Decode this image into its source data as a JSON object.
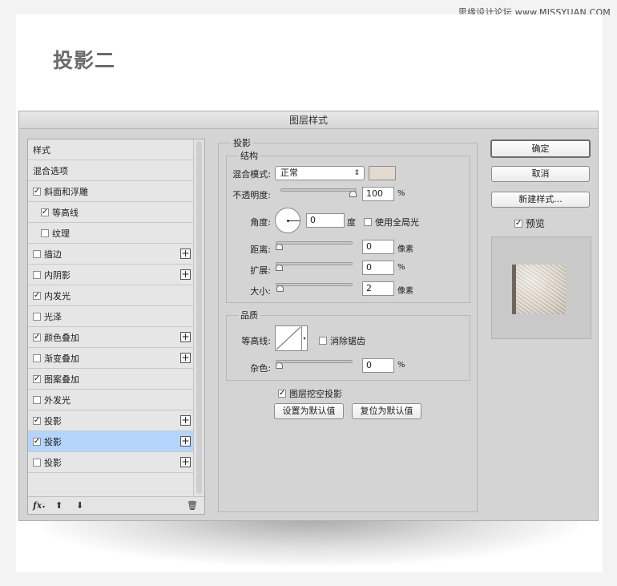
{
  "watermark": "思缘设计论坛 www.MISSYUAN.COM",
  "page_title": "投影二",
  "dialog": {
    "title": "图层样式",
    "style_list": {
      "items": [
        {
          "label": "样式",
          "checkbox": false,
          "checked": false,
          "plus": false,
          "indent": false,
          "selected": false
        },
        {
          "label": "混合选项",
          "checkbox": false,
          "checked": false,
          "plus": false,
          "indent": false,
          "selected": false
        },
        {
          "label": "斜面和浮雕",
          "checkbox": true,
          "checked": true,
          "plus": false,
          "indent": false,
          "selected": false
        },
        {
          "label": "等高线",
          "checkbox": true,
          "checked": true,
          "plus": false,
          "indent": true,
          "selected": false
        },
        {
          "label": "纹理",
          "checkbox": true,
          "checked": false,
          "plus": false,
          "indent": true,
          "selected": false
        },
        {
          "label": "描边",
          "checkbox": true,
          "checked": false,
          "plus": true,
          "indent": false,
          "selected": false
        },
        {
          "label": "内阴影",
          "checkbox": true,
          "checked": false,
          "plus": true,
          "indent": false,
          "selected": false
        },
        {
          "label": "内发光",
          "checkbox": true,
          "checked": true,
          "plus": false,
          "indent": false,
          "selected": false
        },
        {
          "label": "光泽",
          "checkbox": true,
          "checked": false,
          "plus": false,
          "indent": false,
          "selected": false
        },
        {
          "label": "颜色叠加",
          "checkbox": true,
          "checked": true,
          "plus": true,
          "indent": false,
          "selected": false
        },
        {
          "label": "渐变叠加",
          "checkbox": true,
          "checked": false,
          "plus": true,
          "indent": false,
          "selected": false
        },
        {
          "label": "图案叠加",
          "checkbox": true,
          "checked": true,
          "plus": false,
          "indent": false,
          "selected": false
        },
        {
          "label": "外发光",
          "checkbox": true,
          "checked": false,
          "plus": false,
          "indent": false,
          "selected": false
        },
        {
          "label": "投影",
          "checkbox": true,
          "checked": true,
          "plus": true,
          "indent": false,
          "selected": false
        },
        {
          "label": "投影",
          "checkbox": true,
          "checked": true,
          "plus": true,
          "indent": false,
          "selected": true
        },
        {
          "label": "投影",
          "checkbox": true,
          "checked": false,
          "plus": true,
          "indent": false,
          "selected": false
        }
      ],
      "footer": {
        "fx": "fx",
        "up_icon": "arrow-up-icon",
        "down_icon": "arrow-down-icon",
        "trash_icon": "trash-icon"
      }
    },
    "shadow_panel": {
      "section_title": "投影",
      "structure": {
        "title": "结构",
        "blend_mode_label": "混合模式:",
        "blend_mode_value": "正常",
        "blend_color": "#e4d9cf",
        "opacity_label": "不透明度:",
        "opacity_value": "100",
        "opacity_unit": "%",
        "opacity_level": 1.0,
        "angle_label": "角度:",
        "angle_value": "0",
        "angle_unit": "度",
        "global_light_label": "使用全局光",
        "global_light_checked": false,
        "distance_label": "距离:",
        "distance_value": "0",
        "distance_unit": "像素",
        "distance_level": 0,
        "spread_label": "扩展:",
        "spread_value": "0",
        "spread_unit": "%",
        "spread_level": 0,
        "size_label": "大小:",
        "size_value": "2",
        "size_unit": "像素",
        "size_level": 0.01
      },
      "quality": {
        "title": "品质",
        "contour_label": "等高线:",
        "anti_alias_label": "消除锯齿",
        "anti_alias_checked": false,
        "noise_label": "杂色:",
        "noise_value": "0",
        "noise_unit": "%",
        "noise_level": 0
      },
      "knockout_label": "图层挖空投影",
      "knockout_checked": true,
      "make_default_label": "设置为默认值",
      "reset_default_label": "复位为默认值"
    },
    "buttons": {
      "ok": "确定",
      "cancel": "取消",
      "new_style": "新建样式...",
      "preview_label": "预览",
      "preview_checked": true
    }
  }
}
